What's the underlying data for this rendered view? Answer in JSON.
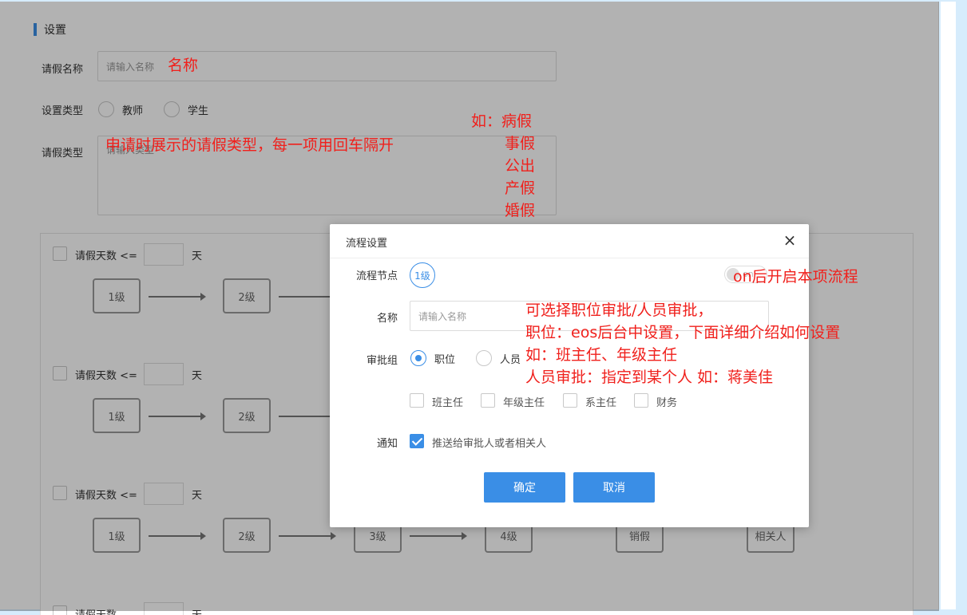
{
  "section_title": "设置",
  "form": {
    "leave_name_label": "请假名称",
    "leave_name_placeholder": "请输入名称",
    "setting_type_label": "设置类型",
    "type_options": [
      "教师",
      "学生"
    ],
    "leave_type_label": "请假类型",
    "leave_type_placeholder": "请输入类型"
  },
  "rules": [
    {
      "label": "请假天数 <=",
      "unit": "天",
      "nodes": [
        "1级",
        "2级"
      ]
    },
    {
      "label": "请假天数 <=",
      "unit": "天",
      "nodes": [
        "1级",
        "2级"
      ]
    },
    {
      "label": "请假天数 <=",
      "unit": "天",
      "nodes": [
        "1级",
        "2级",
        "3级",
        "4级",
        "销假",
        "相关人"
      ]
    },
    {
      "label": "请假天数",
      "unit": "天"
    }
  ],
  "annotations": {
    "name_hint": "名称",
    "type_hint": "申请时展示的请假类型，每一项用回车隔开",
    "examples": [
      "如：病假",
      "事假",
      "公出",
      "产假",
      "婚假"
    ],
    "toggle_hint": "on后开启本项流程",
    "approval_hint": [
      "可选择职位审批/人员审批，",
      "职位：eos后台中设置，下面详细介绍如何设置",
      "如：班主任、年级主任",
      "人员审批：指定到某个人 如：蒋美佳"
    ]
  },
  "modal": {
    "title": "流程设置",
    "close_label": "×",
    "node_label": "流程节点",
    "node_level": "1级",
    "toggle_text": "on",
    "name_label": "名称",
    "name_placeholder": "请输入名称",
    "group_label": "审批组",
    "group_options": [
      "职位",
      "人员"
    ],
    "positions": [
      "班主任",
      "年级主任",
      "系主任",
      "财务"
    ],
    "notify_label": "通知",
    "notify_text": "推送给审批人或者相关人",
    "confirm_label": "确定",
    "cancel_label": "取消"
  },
  "colors": {
    "accent": "#3a8ee6",
    "annotation": "#f0201c"
  }
}
